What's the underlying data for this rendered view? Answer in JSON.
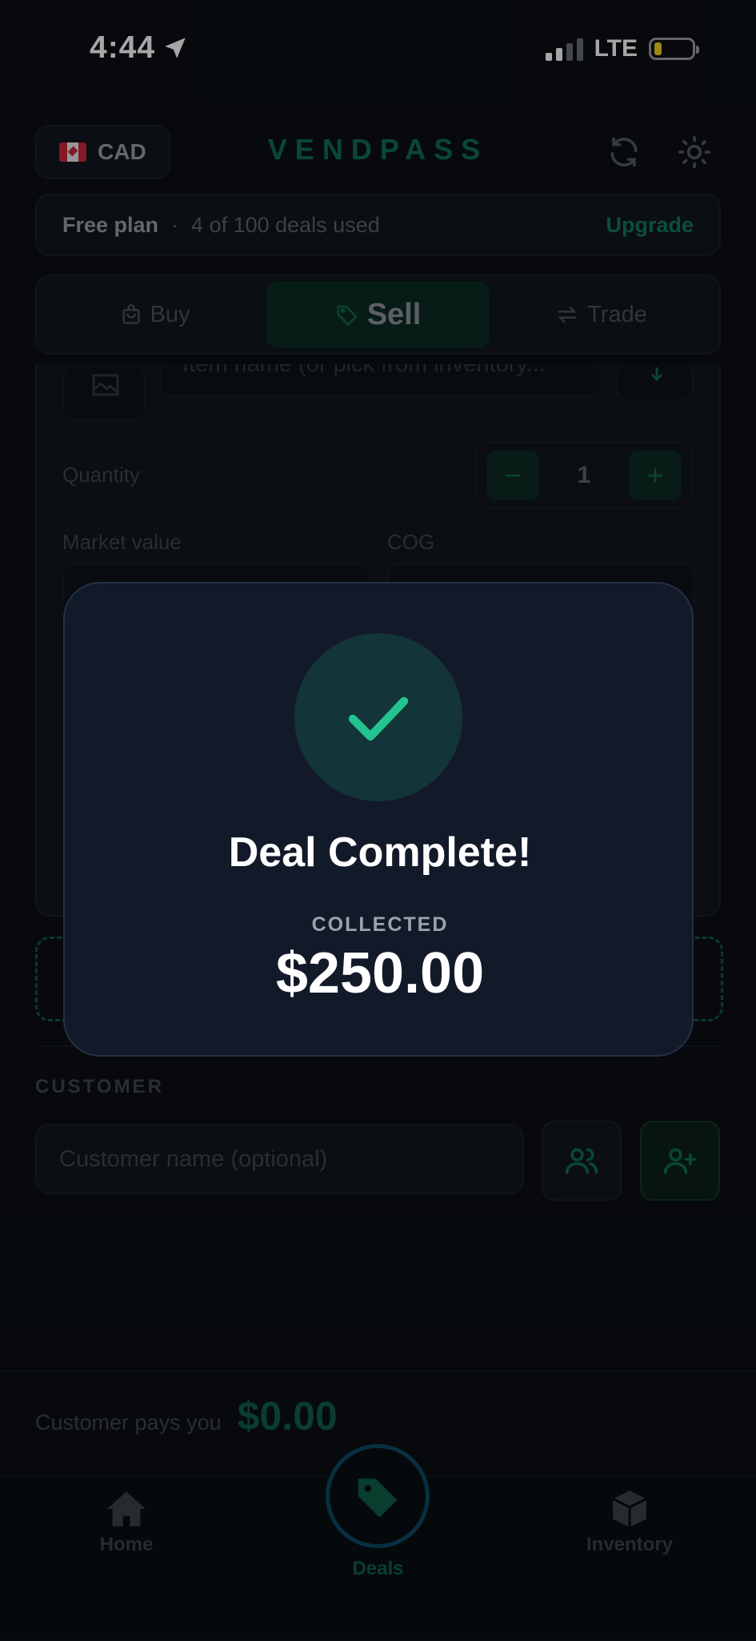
{
  "status": {
    "time": "4:44",
    "network": "LTE"
  },
  "header": {
    "currency_code": "CAD",
    "app_name": "VENDPASS"
  },
  "plan": {
    "name": "Free plan",
    "separator": "·",
    "usage": "4 of 100 deals used",
    "upgrade_label": "Upgrade"
  },
  "tabs": [
    {
      "label": "Buy"
    },
    {
      "label": "Sell"
    },
    {
      "label": "Trade"
    }
  ],
  "form": {
    "item_placeholder": "Item name (or pick from inventory...",
    "quantity_label": "Quantity",
    "quantity_value": "1",
    "minus": "−",
    "plus": "+",
    "market_value_label": "Market value",
    "cog_label": "COG"
  },
  "customer": {
    "section_label": "CUSTOMER",
    "placeholder": "Customer name (optional)"
  },
  "footer": {
    "pays_label": "Customer pays you",
    "pays_amount": "$0.00"
  },
  "nav": {
    "home": "Home",
    "deals": "Deals",
    "inventory": "Inventory"
  },
  "modal": {
    "title": "Deal Complete!",
    "collected_label": "COLLECTED",
    "collected_amount": "$250.00"
  },
  "colors": {
    "accent": "#16a37a",
    "modal_bg": "#121a2a",
    "page_bg": "#0b0f14"
  }
}
